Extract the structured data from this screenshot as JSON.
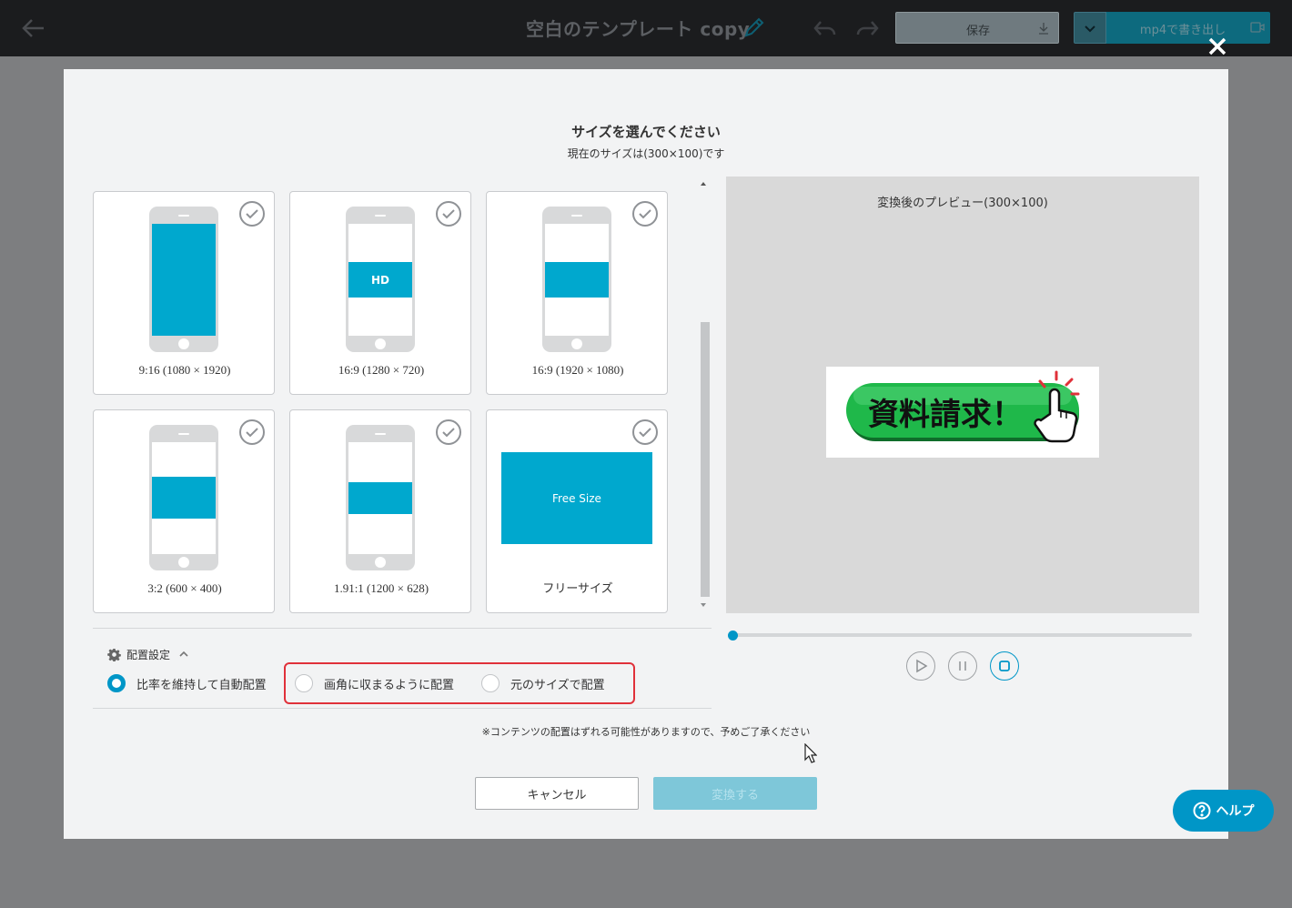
{
  "header": {
    "doc_title": "空白のテンプレート copy",
    "save_label": "保存",
    "export_label": "mp4で書き出し"
  },
  "modal": {
    "title": "サイズを選んでください",
    "subtitle": "現在のサイズは(300×100)です",
    "sizes": [
      {
        "label": "9:16 (1080 × 1920)",
        "badge": ""
      },
      {
        "label": "16:9 (1280 × 720)",
        "badge": "HD"
      },
      {
        "label": "16:9 (1920 × 1080)",
        "badge": ""
      },
      {
        "label": "3:2 (600 × 400)",
        "badge": ""
      },
      {
        "label": "1.91:1 (1200 × 628)",
        "badge": ""
      },
      {
        "label": "フリーサイズ",
        "badge": "Free Size"
      }
    ],
    "preview_label": "変換後のプレビュー(300×100)",
    "preview_banner_text": "資料請求！",
    "arrangement": {
      "heading": "配置設定",
      "options": [
        {
          "label": "比率を維持して自動配置",
          "selected": true
        },
        {
          "label": "画角に収まるように配置",
          "selected": false
        },
        {
          "label": "元のサイズで配置",
          "selected": false
        }
      ]
    },
    "notice": "※コンテンツの配置はずれる可能性がありますので、予めご了承ください",
    "cancel_label": "キャンセル",
    "convert_label": "変換する"
  },
  "help_label": "ヘルプ",
  "colors": {
    "accent": "#00a8ce",
    "highlight": "#e0313a",
    "banner_green": "#1fb84a"
  },
  "playback_progress": 0
}
